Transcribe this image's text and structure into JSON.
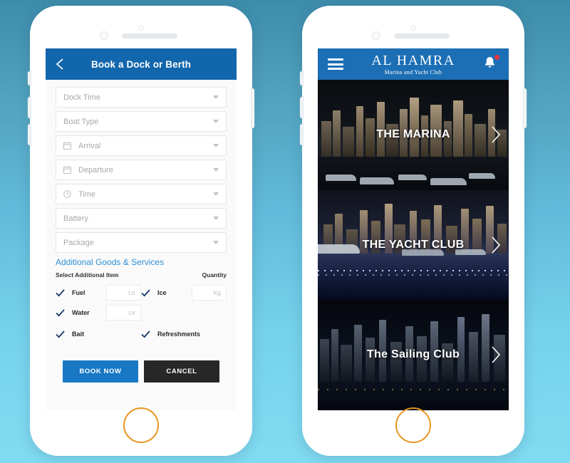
{
  "background": {
    "gradient_top": "#3c8cab",
    "gradient_bottom": "#81dbf2"
  },
  "phone_left": {
    "header": {
      "title": "Book a Dock or Berth",
      "back_icon": "chevron-left-icon",
      "bg_color": "#1166ac"
    },
    "fields": [
      {
        "label": "Dock Time",
        "icon": null
      },
      {
        "label": "Boat Type",
        "icon": null
      },
      {
        "label": "Arrival",
        "icon": "calendar-icon"
      },
      {
        "label": "Departure",
        "icon": "calendar-icon"
      },
      {
        "label": "Time",
        "icon": "clock-icon"
      },
      {
        "label": "Battery",
        "icon": null
      },
      {
        "label": "Package",
        "icon": null
      }
    ],
    "additional": {
      "section_title": "Additional Goods & Services",
      "accent_color": "#2e8fd6",
      "col_left_header": "Select Additional Item",
      "col_right_header": "Quantity",
      "rows": [
        {
          "left": {
            "checked": true,
            "name": "Fuel",
            "qty_placeholder": "Ltr",
            "has_qty": true
          },
          "right": {
            "checked": true,
            "name": "Ice",
            "qty_placeholder": "Kg",
            "has_qty": true
          }
        },
        {
          "left": {
            "checked": true,
            "name": "Water",
            "qty_placeholder": "Ltr",
            "has_qty": true
          },
          "right": {
            "checked": false,
            "name": "",
            "qty_placeholder": "",
            "has_qty": false
          }
        },
        {
          "left": {
            "checked": true,
            "name": "Bait",
            "qty_placeholder": "",
            "has_qty": false
          },
          "right": {
            "checked": true,
            "name": "Refreshments",
            "qty_placeholder": "",
            "has_qty": false
          }
        }
      ]
    },
    "buttons": {
      "primary_label": "BOOK NOW",
      "primary_color": "#1878c4",
      "secondary_label": "CANCEL",
      "secondary_color": "#272727"
    }
  },
  "phone_right": {
    "header": {
      "menu_icon": "hamburger-menu-icon",
      "brand_name": "AL HAMRA",
      "brand_subtitle": "Marina and Yacht Club",
      "bell_icon": "notification-bell-icon",
      "badge_color": "#e8343a",
      "bg_color": "#1c6fb5"
    },
    "cards": [
      {
        "title": "THE MARINA",
        "arrow_icon": "chevron-right-icon"
      },
      {
        "title": "THE YACHT CLUB",
        "arrow_icon": "chevron-right-icon"
      },
      {
        "title": "The Sailing Club",
        "arrow_icon": "chevron-right-icon"
      }
    ]
  },
  "hardware": {
    "home_button_color": "#e8951f",
    "camera_icon": "front-camera",
    "speaker_icon": "earpiece-speaker"
  }
}
